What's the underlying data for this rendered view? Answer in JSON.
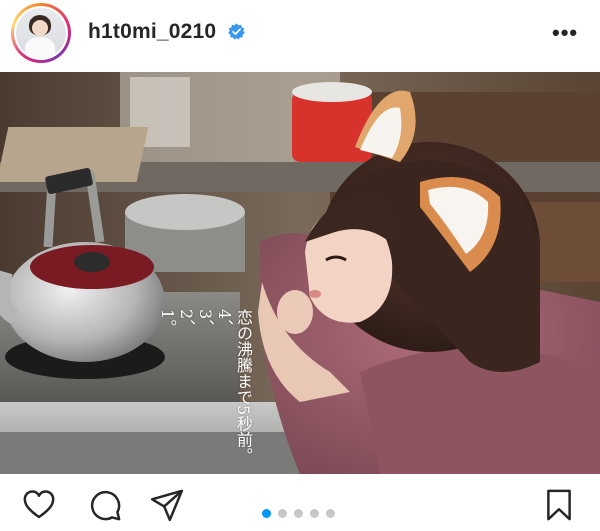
{
  "post": {
    "username": "h1t0mi_0210",
    "verified": true,
    "more_icon": "ellipsis-icon",
    "photo_caption_lines": [
      "恋の沸騰まで5秒前。",
      "4、",
      "3、",
      "2、",
      "1。"
    ],
    "carousel": {
      "total": 5,
      "active_index": 0
    },
    "actions": {
      "like_icon": "heart-icon",
      "comment_icon": "comment-icon",
      "share_icon": "send-icon",
      "save_icon": "bookmark-icon"
    }
  },
  "colors": {
    "accent": "#0095f6",
    "verified_badge": "#3897f0",
    "dot_inactive": "#c7c7c7",
    "text": "#262626"
  }
}
